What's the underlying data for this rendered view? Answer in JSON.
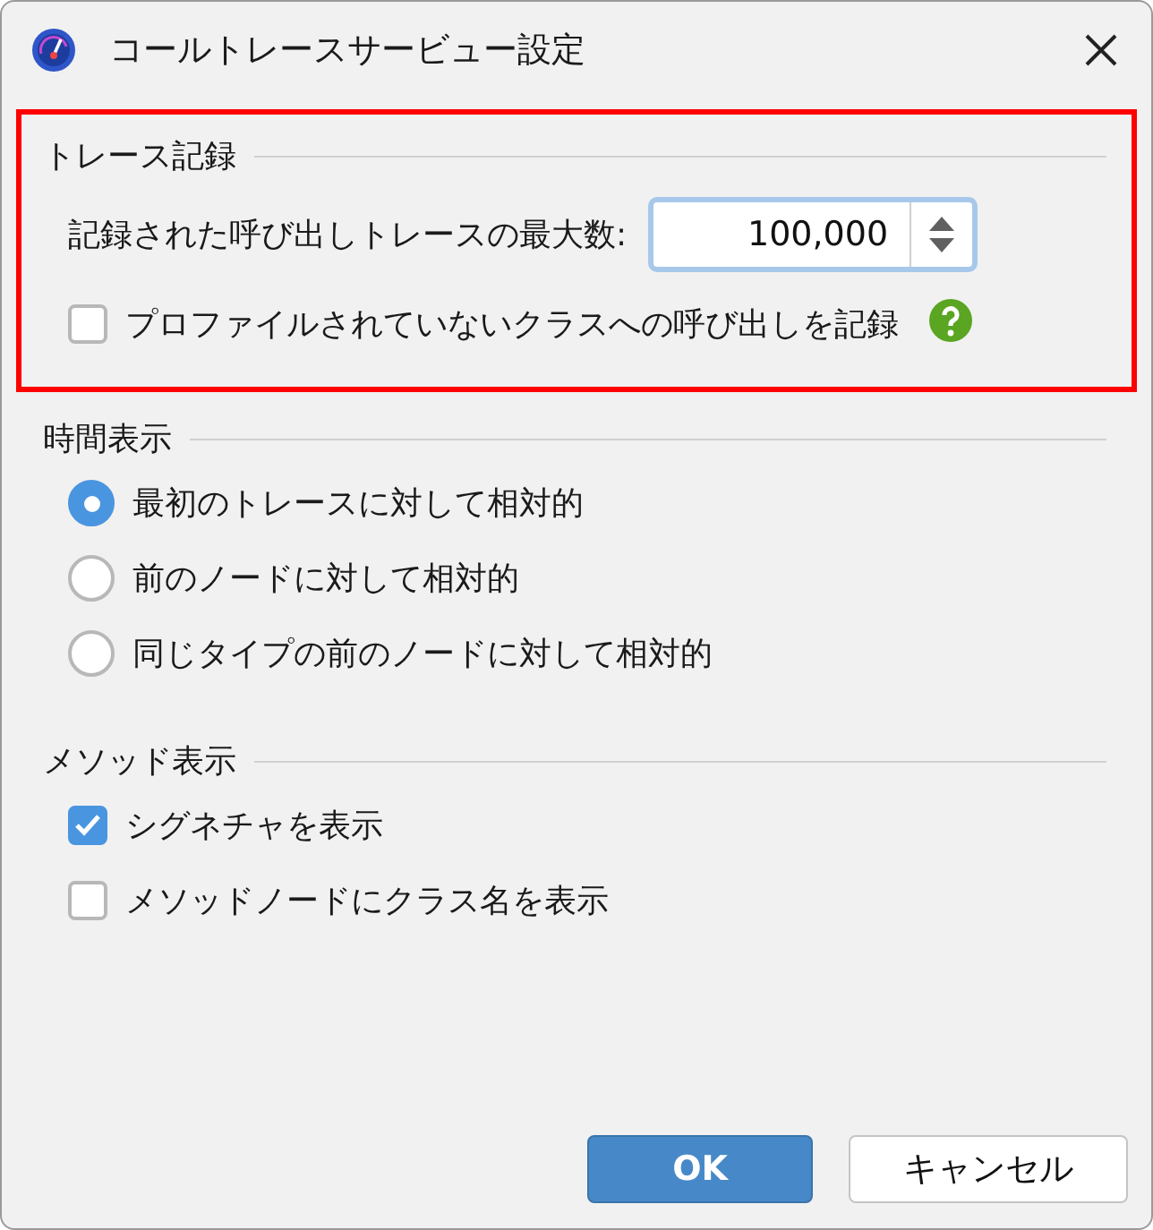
{
  "window": {
    "title": "コールトレースサービュー設定"
  },
  "sections": [
    {
      "title": "トレース記録",
      "highlighted": true,
      "items": [
        {
          "kind": "number",
          "label": "記録された呼び出しトレースの最大数:",
          "value": "100,000"
        },
        {
          "kind": "checkbox",
          "label": "プロファイルされていないクラスへの呼び出しを記録",
          "checked": false,
          "help": true
        }
      ]
    },
    {
      "title": "時間表示",
      "highlighted": false,
      "items": [
        {
          "kind": "radio",
          "label": "最初のトレースに対して相対的",
          "selected": true
        },
        {
          "kind": "radio",
          "label": "前のノードに対して相対的",
          "selected": false
        },
        {
          "kind": "radio",
          "label": "同じタイプの前のノードに対して相対的",
          "selected": false
        }
      ]
    },
    {
      "title": "メソッド表示",
      "highlighted": false,
      "items": [
        {
          "kind": "checkbox",
          "label": "シグネチャを表示",
          "checked": true,
          "help": false
        },
        {
          "kind": "checkbox",
          "label": "メソッドノードにクラス名を表示",
          "checked": false,
          "help": false
        }
      ]
    }
  ],
  "buttons": [
    {
      "label": "OK",
      "primary": true
    },
    {
      "label": "キャンセル",
      "primary": false
    }
  ]
}
